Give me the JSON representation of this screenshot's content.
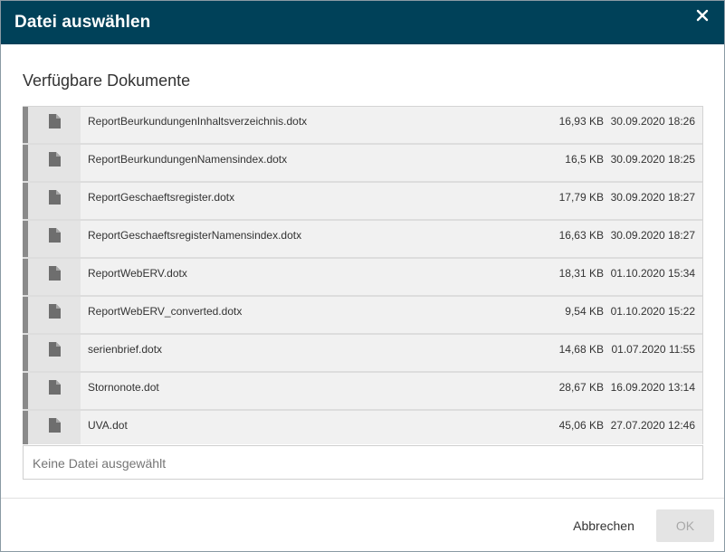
{
  "dialog": {
    "title": "Datei auswählen",
    "close_icon": "close-icon",
    "header_color": "#004159"
  },
  "section": {
    "title": "Verfügbare Dokumente"
  },
  "files": [
    {
      "name": "ReportBeurkundungenInhaltsverzeichnis.dotx",
      "size": "16,93 KB",
      "date": "30.09.2020 18:26",
      "icon": "file-icon"
    },
    {
      "name": "ReportBeurkundungenNamensindex.dotx",
      "size": "16,5 KB",
      "date": "30.09.2020 18:25",
      "icon": "file-icon"
    },
    {
      "name": "ReportGeschaeftsregister.dotx",
      "size": "17,79 KB",
      "date": "30.09.2020 18:27",
      "icon": "file-icon"
    },
    {
      "name": "ReportGeschaeftsregisterNamensindex.dotx",
      "size": "16,63 KB",
      "date": "30.09.2020 18:27",
      "icon": "file-icon"
    },
    {
      "name": "ReportWebERV.dotx",
      "size": "18,31 KB",
      "date": "01.10.2020 15:34",
      "icon": "file-icon"
    },
    {
      "name": "ReportWebERV_converted.dotx",
      "size": "9,54 KB",
      "date": "01.10.2020 15:22",
      "icon": "file-icon"
    },
    {
      "name": "serienbrief.dotx",
      "size": "14,68 KB",
      "date": "01.07.2020 11:55",
      "icon": "file-icon"
    },
    {
      "name": "Stornonote.dot",
      "size": "28,67 KB",
      "date": "16.09.2020 13:14",
      "icon": "file-icon"
    },
    {
      "name": "UVA.dot",
      "size": "45,06 KB",
      "date": "27.07.2020 12:46",
      "icon": "file-icon"
    }
  ],
  "selection": {
    "text": "Keine Datei ausgewählt"
  },
  "footer": {
    "cancel_label": "Abbrechen",
    "ok_label": "OK"
  }
}
